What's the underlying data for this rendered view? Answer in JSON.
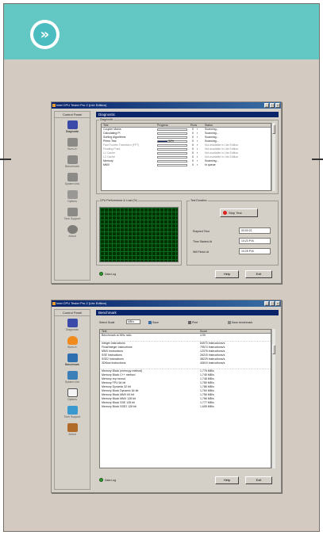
{
  "badge": {
    "glyph": "»"
  },
  "colors": {
    "teal": "#63c7c4",
    "background": "#d3cbc2",
    "titlebar": "#0a246a"
  },
  "window1": {
    "title": "Intel CPU Tester Pro 2 (Lite Edition)",
    "control_panel_title": "Control Panel",
    "sidebar": [
      {
        "label": "Diagnostic",
        "icon": "monitor-icon"
      },
      {
        "label": "Burn-in",
        "icon": "flame-icon"
      },
      {
        "label": "Benchmark",
        "icon": "gauge-icon"
      },
      {
        "label": "System Info",
        "icon": "computer-icon"
      },
      {
        "label": "Options",
        "icon": "options-icon"
      },
      {
        "label": "Tech Support",
        "icon": "support-icon"
      },
      {
        "label": "About",
        "icon": "cube-icon"
      }
    ],
    "header": "Diagnostic",
    "group_label": "Diagnostic",
    "columns": [
      "Test",
      "Progress",
      "Runs",
      "Status"
    ],
    "rows": [
      {
        "test": "Coupler Mains",
        "runs": "0",
        "status": "Scanning...",
        "progress": 0
      },
      {
        "test": "Calculating Pi",
        "runs": "0",
        "status": "Scanning...",
        "progress": 0
      },
      {
        "test": "Sorting Algorithms",
        "runs": "0",
        "status": "Scanning...",
        "progress": 0
      },
      {
        "test": "Prime Test",
        "runs": "0",
        "status": "Scanning...",
        "progress": 0.32,
        "progress_text": "32%"
      },
      {
        "test": "Fast Fourier Transform (FFT)",
        "runs": "0",
        "status": "Not available in Lite Edition",
        "progress": 0
      },
      {
        "test": "Floating Point",
        "runs": "0",
        "status": "Not available in Lite Edition",
        "progress": 0
      },
      {
        "test": "L1 Cache",
        "runs": "0",
        "status": "Not available in Lite Edition",
        "progress": 0
      },
      {
        "test": "L2 Cache",
        "runs": "0",
        "status": "Not available in Lite Edition",
        "progress": 0
      },
      {
        "test": "Memory",
        "runs": "0",
        "status": "Scanning...",
        "progress": 0
      },
      {
        "test": "MMX",
        "runs": "0",
        "status": "In queue",
        "progress": 0
      }
    ],
    "performance_label": "CPU Performance & Load (%)",
    "test_duration_label": "Test Duration",
    "stop_button": "Stop Test",
    "elapsed_label": "Elapsed Time",
    "elapsed_value": "00:00:21",
    "started_label": "Time Started At",
    "started_value": "10:23 P.M.",
    "finished_label": "Will Finish At",
    "finished_value": "10:25 P.M.",
    "status_text": "Data Log",
    "help_button": "Help",
    "exit_button": "Exit"
  },
  "window2": {
    "title": "Intel CPU Tester Pro 2 (Lite Edition)",
    "control_panel_title": "Control Panel",
    "sidebar": [
      {
        "label": "Diagnostic",
        "icon": "monitor-icon"
      },
      {
        "label": "Burn-in",
        "icon": "flame-icon"
      },
      {
        "label": "Benchmark",
        "icon": "gauge-icon"
      },
      {
        "label": "System Info",
        "icon": "computer-icon"
      },
      {
        "label": "Options",
        "icon": "options-icon"
      },
      {
        "label": "Tech Support",
        "icon": "support-icon"
      },
      {
        "label": "About",
        "icon": "cube-icon"
      }
    ],
    "header": "Benchmark",
    "toolbar": {
      "combo_label": "Select Scale",
      "combo_value": "MB/s",
      "save": "Save",
      "print": "Print",
      "compare": "Save benchmark"
    },
    "columns": [
      "Test",
      "Score"
    ],
    "rows": [
      {
        "test": "Benchmark at MHz ratio",
        "score": "4.99"
      },
      {
        "test": "",
        "score": ""
      },
      {
        "test": "Integer Instructions",
        "score": "64970 Instructions/s"
      },
      {
        "test": "Float/Integer Instructions",
        "score": "79574 Instructions/s"
      },
      {
        "test": "MMX Instructions",
        "score": "12376 Instructions/s"
      },
      {
        "test": "SSE Instructions",
        "score": "26215 Instructions/s"
      },
      {
        "test": "SSE2 Instructions",
        "score": "38229 Instructions/s"
      },
      {
        "test": "3DNow Instructions",
        "score": "40619 Instructions/s"
      },
      {
        "test": "",
        "score": ""
      },
      {
        "test": "Memory Block (memcpy method)",
        "score": "1,776 MB/s"
      },
      {
        "test": "Memory Block C++ method",
        "score": "1,745 MB/s"
      },
      {
        "test": "Memory rep movsd",
        "score": "1,748 MB/s"
      },
      {
        "test": "Memory FPU 64 bit",
        "score": "1,789 MB/s"
      },
      {
        "test": "Memory Dynamic 32 bit",
        "score": "1,788 MB/s"
      },
      {
        "test": "Memory Block Dynamic 64 bit",
        "score": "1,760 MB/s"
      },
      {
        "test": "Memory Block MMX 64 bit",
        "score": "1,756 MB/s"
      },
      {
        "test": "Memory Block MMX 128 bit",
        "score": "1,756 MB/s"
      },
      {
        "test": "Memory Block SSE 128 bit",
        "score": "1,777 MB/s"
      },
      {
        "test": "Memory Block SSE2 128 bit",
        "score": "1,605 MB/s"
      }
    ],
    "status_text": "Data Log",
    "help_button": "Help",
    "exit_button": "Exit"
  }
}
